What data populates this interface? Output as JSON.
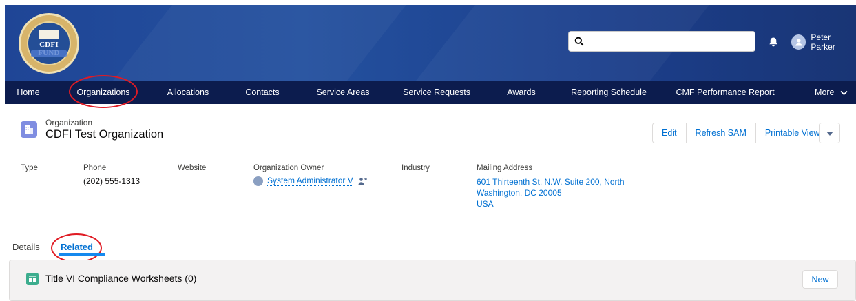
{
  "header": {
    "logo_text": "CDFI FUND",
    "search": {
      "value": "",
      "placeholder": ""
    },
    "user_name": "Peter Parker"
  },
  "nav": {
    "items": [
      "Home",
      "Organizations",
      "Allocations",
      "Contacts",
      "Service Areas",
      "Service Requests",
      "Awards",
      "Reporting Schedule",
      "CMF Performance Report"
    ],
    "more_label": "More"
  },
  "record": {
    "object_label": "Organization",
    "title": "CDFI Test Organization",
    "actions": [
      "Edit",
      "Refresh SAM",
      "Printable View"
    ]
  },
  "fields": {
    "type_label": "Type",
    "phone_label": "Phone",
    "phone_value": "(202) 555-1313",
    "website_label": "Website",
    "owner_label": "Organization Owner",
    "owner_value": "System Administrator V",
    "industry_label": "Industry",
    "address_label": "Mailing Address",
    "address_line1": "601 Thirteenth St, N.W. Suite 200, North",
    "address_line2": "Washington, DC 20005",
    "address_line3": "USA"
  },
  "tabs": {
    "details": "Details",
    "related": "Related"
  },
  "related_card": {
    "title": "Title VI Compliance Worksheets (0)",
    "new_label": "New"
  },
  "colors": {
    "header_blue": "#1f4596",
    "nav_navy": "#0c1c4e",
    "link_blue": "#0070d2",
    "annotation_red": "#e01b24",
    "related_icon_green": "#3cad8e",
    "record_icon_purple": "#7f8de1"
  },
  "icons": [
    "search-icon",
    "bell-icon",
    "user-avatar-icon",
    "chevron-down-icon",
    "organization-record-icon",
    "owner-avatar-icon",
    "change-owner-icon",
    "dropdown-arrow-icon",
    "worksheet-icon"
  ]
}
